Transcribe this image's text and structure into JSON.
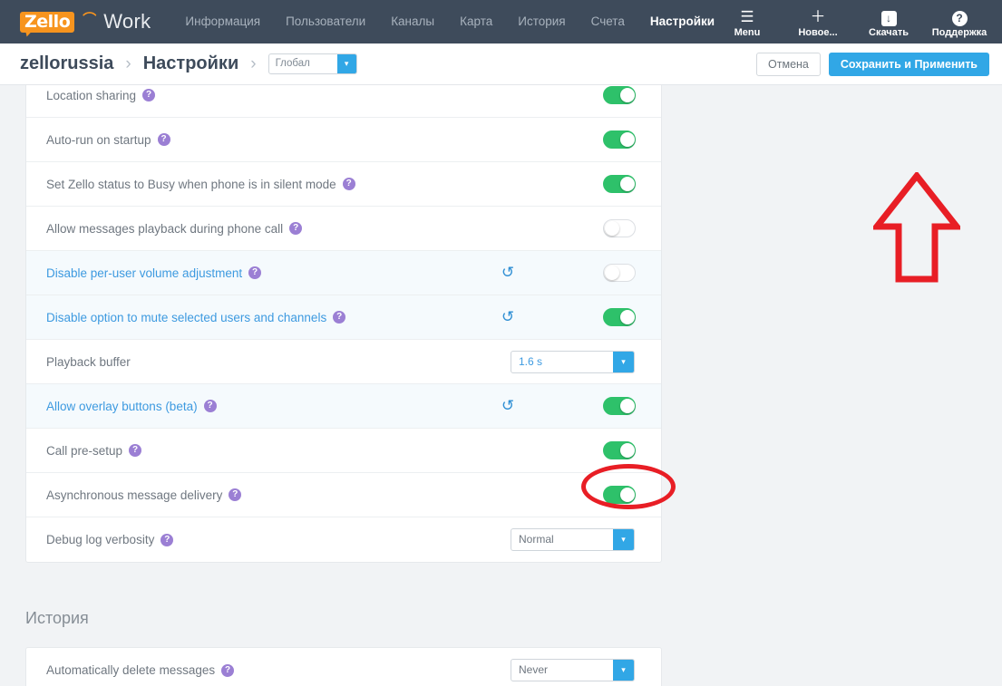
{
  "navbar": {
    "logo_text": "Zello",
    "logo_wave_icon": "signal-wave-icon",
    "brand_word": "Work",
    "links": [
      {
        "label": "Информация",
        "active": false
      },
      {
        "label": "Пользователи",
        "active": false
      },
      {
        "label": "Каналы",
        "active": false
      },
      {
        "label": "Карта",
        "active": false
      },
      {
        "label": "История",
        "active": false
      },
      {
        "label": "Счета",
        "active": false
      },
      {
        "label": "Настройки",
        "active": true
      }
    ],
    "tools": [
      {
        "label": "Menu",
        "icon": "hamburger-menu-icon",
        "glyph": "☰"
      },
      {
        "label": "Новое...",
        "icon": "plus-icon",
        "glyph": "＋"
      },
      {
        "label": "Скачать",
        "icon": "download-icon",
        "glyph": "↓"
      },
      {
        "label": "Поддержка",
        "icon": "question-circle-icon",
        "glyph": "?"
      }
    ]
  },
  "subbar": {
    "org": "zellorussia",
    "separator": "›",
    "page": "Настройки",
    "scope_select": {
      "value": "Глобал",
      "arrow_icon": "chevron-down-icon"
    },
    "cancel_label": "Отмена",
    "save_label": "Сохранить и Применить"
  },
  "settings": {
    "rows": [
      {
        "label": "Location sharing",
        "help_icon": "question-help-icon",
        "modified": false,
        "control": "toggle",
        "toggle_on": true,
        "reset": false
      },
      {
        "label": "Auto-run on startup",
        "help_icon": "question-help-icon",
        "modified": false,
        "control": "toggle",
        "toggle_on": true,
        "reset": false
      },
      {
        "label": "Set Zello status to Busy when phone is in silent mode",
        "help_icon": "question-help-icon",
        "modified": false,
        "control": "toggle",
        "toggle_on": true,
        "reset": false
      },
      {
        "label": "Allow messages playback during phone call",
        "help_icon": "question-help-icon",
        "modified": false,
        "control": "toggle",
        "toggle_on": false,
        "reset": false
      },
      {
        "label": "Disable per-user volume adjustment",
        "help_icon": "question-help-icon",
        "modified": true,
        "control": "toggle",
        "toggle_on": false,
        "reset": true,
        "reset_icon": "reset-undo-icon"
      },
      {
        "label": "Disable option to mute selected users and channels",
        "help_icon": "question-help-icon",
        "modified": true,
        "control": "toggle",
        "toggle_on": true,
        "reset": true,
        "reset_icon": "reset-undo-icon"
      },
      {
        "label": "Playback buffer",
        "help_icon": null,
        "modified": false,
        "control": "select",
        "select_value": "1.6 s",
        "select_modified": true,
        "reset": false
      },
      {
        "label": "Allow overlay buttons (beta)",
        "help_icon": "question-help-icon",
        "modified": true,
        "control": "toggle",
        "toggle_on": true,
        "reset": true,
        "reset_icon": "reset-undo-icon",
        "highlighted": true
      },
      {
        "label": "Call pre-setup",
        "help_icon": "question-help-icon",
        "modified": false,
        "control": "toggle",
        "toggle_on": true,
        "reset": false
      },
      {
        "label": "Asynchronous message delivery",
        "help_icon": "question-help-icon",
        "modified": false,
        "control": "toggle",
        "toggle_on": true,
        "reset": false
      },
      {
        "label": "Debug log verbosity",
        "help_icon": "question-help-icon",
        "modified": false,
        "control": "select",
        "select_value": "Normal",
        "select_modified": false,
        "reset": false
      }
    ]
  },
  "history_section": {
    "title": "История",
    "rows": [
      {
        "label": "Automatically delete messages",
        "help_icon": "question-help-icon",
        "modified": false,
        "control": "select",
        "select_value": "Never",
        "select_modified": false,
        "reset": false
      }
    ]
  },
  "annotations": {
    "ellipse": {
      "name": "red-ellipse-highlight",
      "color": "#e81e25",
      "target": "Allow overlay buttons (beta) toggle"
    },
    "arrow": {
      "name": "red-up-arrow",
      "color": "#e81e25",
      "target": "Сохранить и Применить button"
    }
  },
  "help_glyph": "?",
  "reset_glyph": "↺",
  "chevron_glyph": "▾"
}
